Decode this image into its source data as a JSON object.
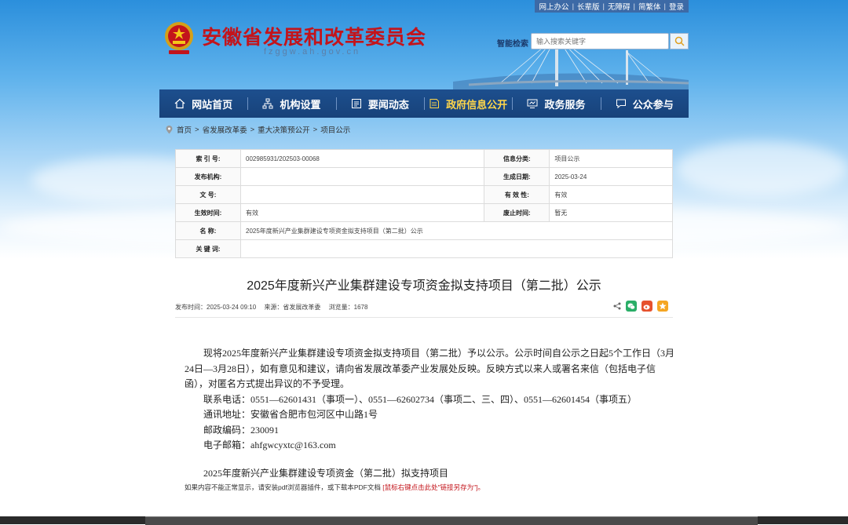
{
  "topbar": {
    "items": [
      "网上办公",
      "长辈版",
      "无障碍",
      "简繁体",
      "登录"
    ]
  },
  "header": {
    "title": "安徽省发展和改革委员会",
    "domain": "fzggw.ah.gov.cn",
    "search_label": "智能检索",
    "search_placeholder": "输入搜索关键字"
  },
  "nav": {
    "items": [
      {
        "label": "网站首页",
        "icon": "home-icon"
      },
      {
        "label": "机构设置",
        "icon": "org-chart-icon"
      },
      {
        "label": "要闻动态",
        "icon": "news-icon"
      },
      {
        "label": "政府信息公开",
        "icon": "document-icon",
        "active": true
      },
      {
        "label": "政务服务",
        "icon": "monitor-icon"
      },
      {
        "label": "公众参与",
        "icon": "chat-icon"
      }
    ]
  },
  "breadcrumb": {
    "items": [
      "首页",
      "省发展改革委",
      "重大决策预公开",
      "项目公示"
    ]
  },
  "meta": {
    "index_label": "索 引 号:",
    "index_value": "002985931/202503-00068",
    "category_label": "信息分类:",
    "category_value": "项目公示",
    "publisher_label": "发布机构:",
    "publisher_value": "",
    "created_label": "生成日期:",
    "created_value": "2025-03-24",
    "docno_label": "文      号:",
    "docno_value": "",
    "validity_label": "有 效 性:",
    "validity_value": "有效",
    "effective_label": "生效时间:",
    "effective_value": "有效",
    "abolish_label": "废止时间:",
    "abolish_value": "暂无",
    "name_label": "名      称:",
    "name_value": "2025年度新兴产业集群建设专项资金拟支持项目（第二批）公示",
    "keywords_label": "关 键 词:",
    "keywords_value": ""
  },
  "article": {
    "title": "2025年度新兴产业集群建设专项资金拟支持项目（第二批）公示",
    "publish_time": "发布时间：2025-03-24 09:10",
    "source": "来源：省发展改革委",
    "views": "浏览量：1678",
    "para1": "现将2025年度新兴产业集群建设专项资金拟支持项目（第二批）予以公示。公示时间自公示之日起5个工作日（3月24日—3月28日），如有意见和建议，请向省发展改革委产业发展处反映。反映方式以来人或署名来信（包括电子信函），对匿名方式提出异议的不予受理。",
    "phone": "联系电话：0551—62601431（事项一）、0551—62602734（事项二、三、四）、0551—62601454（事项五）",
    "address": "通讯地址：安徽省合肥市包河区中山路1号",
    "postcode": "邮政编码：230091",
    "email": "电子邮箱：ahfgwcyxtc@163.com",
    "list_title": "2025年度新兴产业集群建设专项资金（第二批）拟支持项目",
    "notice_prefix": "如果内容不能正常显示，请安装pdf浏览器插件，或下载本PDF文档",
    "notice_link": "[鼠标右键点击此处\"链接另存为\"]。"
  },
  "colors": {
    "brand_red": "#c3141b",
    "nav_blue": "#1d4f8e",
    "nav_active": "#ffd64a",
    "wechat": "#2aae67",
    "weibo": "#e6512d",
    "favorite": "#f5a623"
  }
}
